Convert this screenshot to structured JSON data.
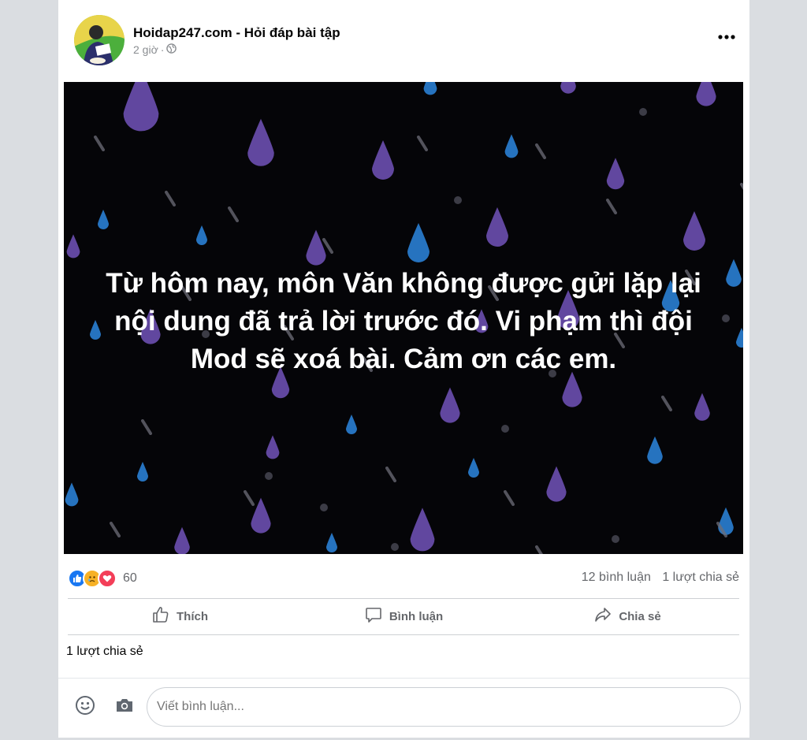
{
  "post": {
    "page_name": "Hoidap247.com - Hỏi đáp bài tập",
    "time": "2 giờ",
    "time_separator": "·",
    "image_text_lines": [
      "Từ hôm nay, môn Văn không được gửi lặp lại",
      "nội dung đã trả lời trước đó. Vi phạm thì đội",
      "Mod sẽ xoá bài. Cảm ơn các em."
    ]
  },
  "reactions": {
    "icons": [
      "like-icon",
      "sad-icon",
      "love-icon"
    ],
    "count": "60"
  },
  "stats": {
    "comments": "12 bình luận",
    "shares": "1 lượt chia sẻ"
  },
  "actions": {
    "like": "Thích",
    "comment": "Bình luận",
    "share": "Chia sẻ"
  },
  "share_line": "1 lượt chia sẻ",
  "comment_input": {
    "placeholder": "Viết bình luận..."
  },
  "colors": {
    "like_blue": "#1877f2",
    "sad_yellow": "#f7b125",
    "love_red": "#f33e58",
    "image_bg": "#050508",
    "drop_purple": "#6b4fb0",
    "drop_blue": "#2a7fd4"
  }
}
